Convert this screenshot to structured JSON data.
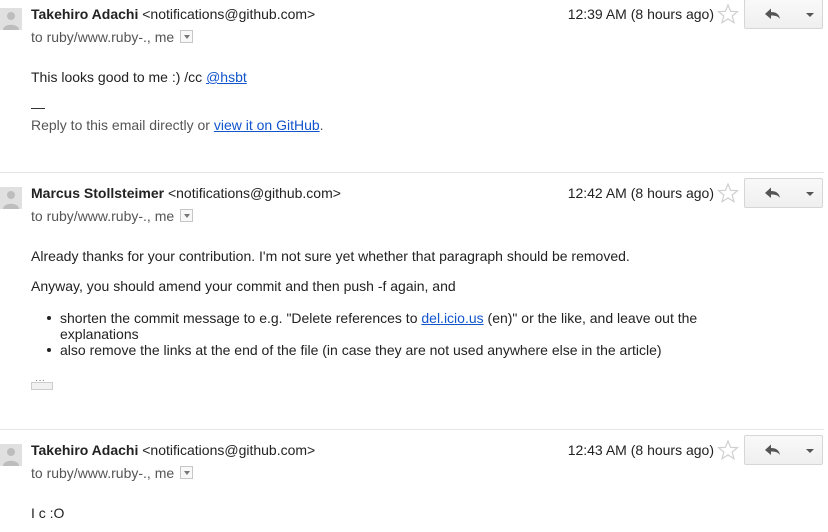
{
  "messages": [
    {
      "sender_name": "Takehiro Adachi",
      "sender_email": "<notifications@github.com>",
      "recipients": "to ruby/www.ruby-., me",
      "timestamp": "12:39 AM (8 hours ago)",
      "body_text": "This looks good to me :) /cc ",
      "mention": "@hsbt",
      "sig_dash": "—",
      "footer_prefix": "Reply to this email directly or ",
      "footer_link": "view it on GitHub",
      "footer_suffix": "."
    },
    {
      "sender_name": "Marcus Stollsteimer",
      "sender_email": "<notifications@github.com>",
      "recipients": "to ruby/www.ruby-., me",
      "timestamp": "12:42 AM (8 hours ago)",
      "para1": "Already thanks for your contribution. I'm not sure yet whether that paragraph should be removed.",
      "para2": "Anyway, you should amend your commit and then push -f again, and",
      "bullet1_prefix": "shorten the commit message to e.g. \"Delete references to ",
      "bullet1_link": "del.icio.us",
      "bullet1_suffix": " (en)\" or the like, and leave out the explanations",
      "bullet2": "also remove the links at the end of the file (in case they are not used anywhere else in the article)"
    },
    {
      "sender_name": "Takehiro Adachi",
      "sender_email": "<notifications@github.com>",
      "recipients": "to ruby/www.ruby-., me",
      "timestamp": "12:43 AM (8 hours ago)",
      "body_text": "I c :O"
    }
  ],
  "icons": {
    "avatar": "avatar-icon",
    "star": "star-icon",
    "reply": "reply-icon",
    "more": "chevron-down-icon"
  },
  "colors": {
    "link": "#1155cc",
    "separator": "#e5e5e5"
  }
}
